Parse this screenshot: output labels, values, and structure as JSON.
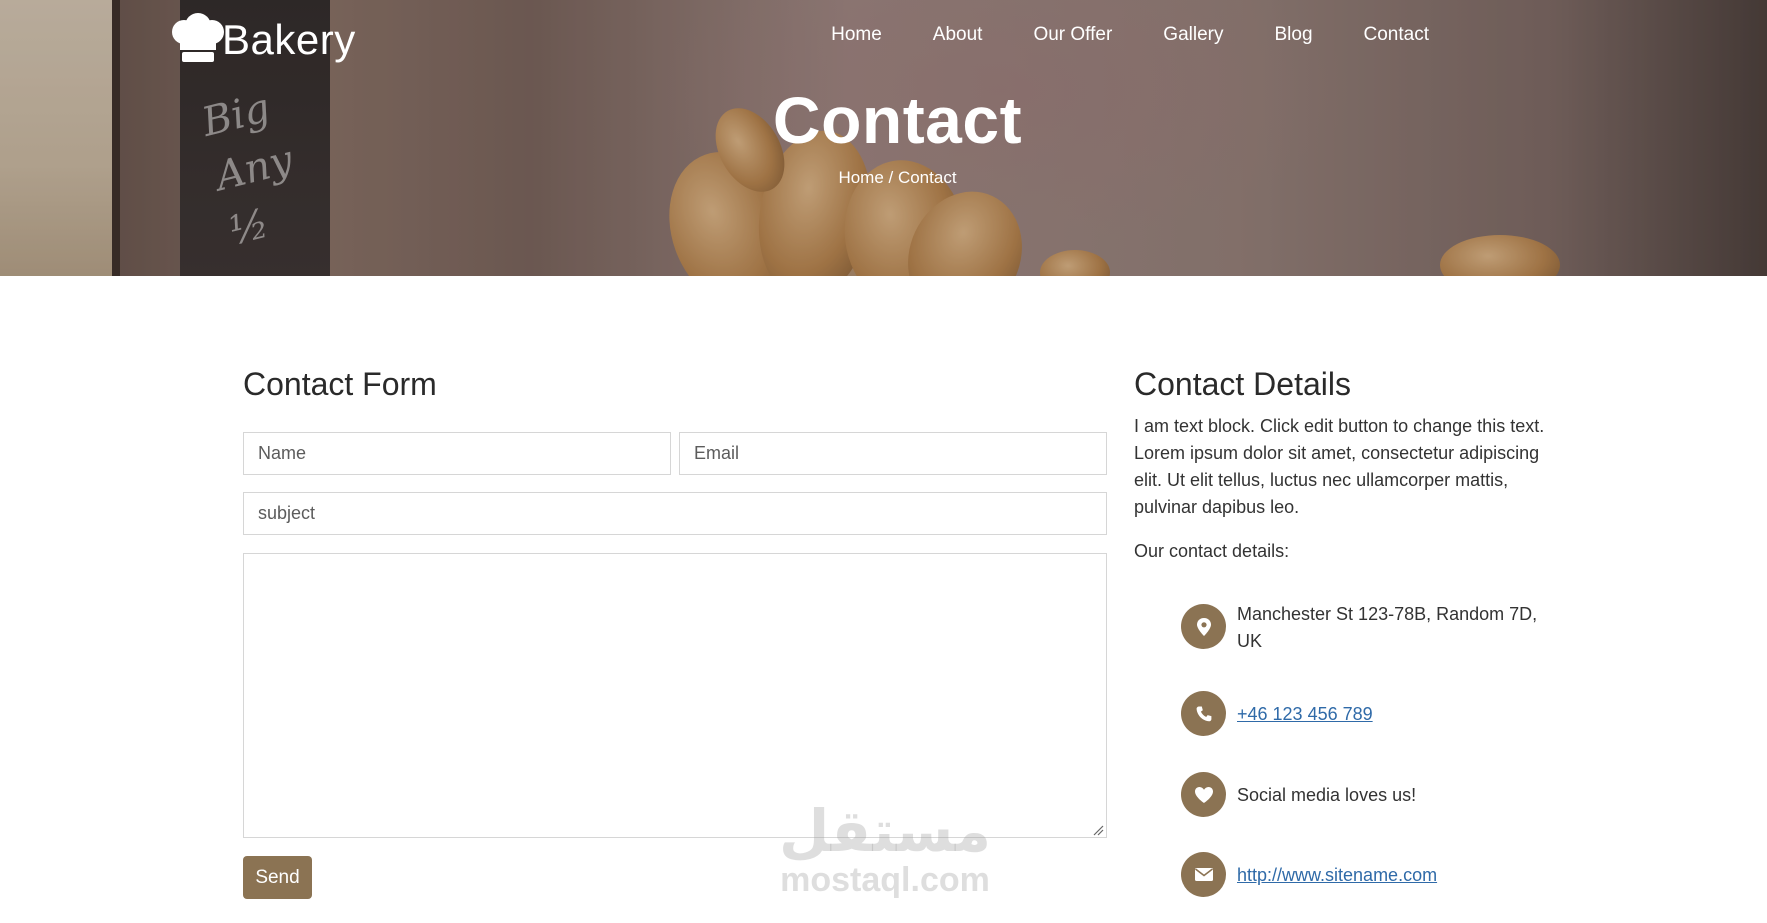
{
  "header": {
    "brand": "Bakery",
    "nav": [
      "Home",
      "About",
      "Our Offer",
      "Gallery",
      "Blog",
      "Contact"
    ],
    "page_title": "Contact",
    "breadcrumb": "Home / Contact",
    "chalkboard_text": "Big Any ½"
  },
  "form": {
    "title": "Contact Form",
    "name_placeholder": "Name",
    "email_placeholder": "Email",
    "subject_placeholder": "subject",
    "message_value": "",
    "send_label": "Send"
  },
  "details": {
    "title": "Contact Details",
    "text": "I am text block. Click edit button to change this text. Lorem ipsum dolor sit amet, consectetur adipiscing elit. Ut elit tellus, luctus nec ullamcorper mattis, pulvinar dapibus leo.",
    "subtitle": "Our contact details:",
    "items": [
      {
        "icon": "location-pin-icon",
        "text": "Manchester St 123-78B, Random 7D, UK"
      },
      {
        "icon": "phone-icon",
        "text": "+46 123 456 789"
      },
      {
        "icon": "heart-icon",
        "text": "Social media loves us!"
      },
      {
        "icon": "envelope-icon",
        "text": "http://www.sitename.com"
      }
    ]
  },
  "watermark": {
    "arabic": "مستقل",
    "latin": "mostaql.com"
  },
  "colors": {
    "accent": "#8b7353",
    "link": "#2f6aa8",
    "heading": "#2a2a2a",
    "border": "#d6d6d6"
  }
}
